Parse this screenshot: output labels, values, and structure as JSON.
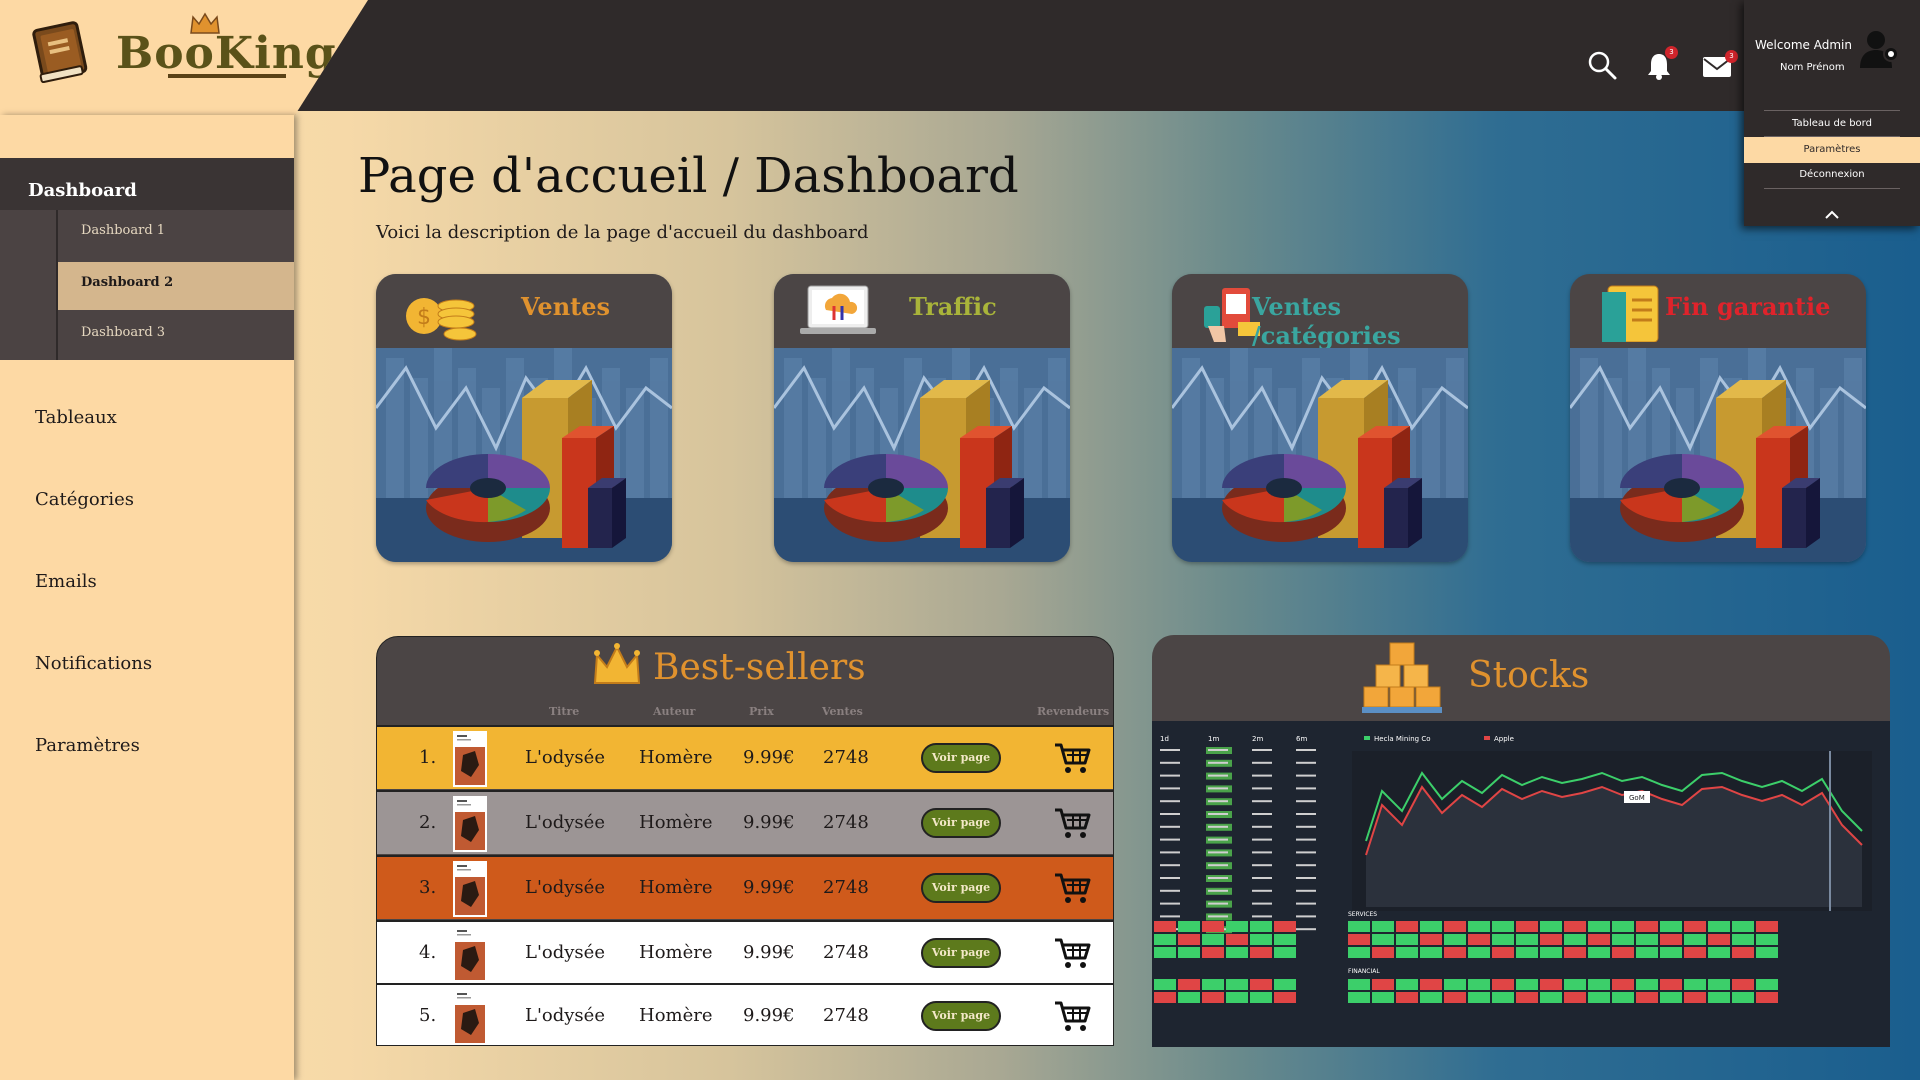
{
  "app": {
    "logo_text": "BooKing"
  },
  "header": {
    "notif_count": "3",
    "mail_count": "3"
  },
  "user_menu": {
    "welcome": "Welcome Admin",
    "name": "Nom Prénom",
    "items": [
      "Tableau de bord",
      "Paramètres",
      "Déconnexion"
    ]
  },
  "sidebar": {
    "section": "Dashboard",
    "sub_items": [
      "Dashboard 1",
      "Dashboard 2",
      "Dashboard 3"
    ],
    "items": [
      "Tableaux",
      "Catégories",
      "Emails",
      "Notifications",
      "Paramètres"
    ]
  },
  "page": {
    "title": "Page d'accueil / Dashboard",
    "description": "Voici la description de la page d'accueil du dashboard"
  },
  "cards": [
    {
      "title": "Ventes",
      "color": "#e0922e",
      "icon": "coins-icon"
    },
    {
      "title": "Traffic",
      "color": "#a9b43a",
      "icon": "laptop-cloud-icon"
    },
    {
      "title": "Ventes /catégories",
      "color": "#3aa6a0",
      "icon": "payment-icon"
    },
    {
      "title": "Fin garantie",
      "color": "#e0232b",
      "icon": "document-icon"
    }
  ],
  "bestsellers": {
    "title": "Best-sellers",
    "columns": [
      "Titre",
      "Auteur",
      "Prix",
      "Ventes",
      "Revendeurs"
    ],
    "button_label": "Voir page",
    "rows": [
      {
        "rank": "1.",
        "title": "L'odysée",
        "author": "Homère",
        "price": "9.99€",
        "sales": "2748",
        "color": "#f2b533"
      },
      {
        "rank": "2.",
        "title": "L'odysée",
        "author": "Homère",
        "price": "9.99€",
        "sales": "2748",
        "color": "#9c9595"
      },
      {
        "rank": "3.",
        "title": "L'odysée",
        "author": "Homère",
        "price": "9.99€",
        "sales": "2748",
        "color": "#cf5a1b"
      },
      {
        "rank": "4.",
        "title": "L'odysée",
        "author": "Homère",
        "price": "9.99€",
        "sales": "2748",
        "color": "#ffffff"
      },
      {
        "rank": "5.",
        "title": "L'odysée",
        "author": "Homère",
        "price": "9.99€",
        "sales": "2748",
        "color": "#ffffff"
      }
    ]
  },
  "stocks": {
    "title": "Stocks",
    "table_headers": [
      "1d",
      "1m",
      "2m",
      "6m"
    ],
    "legend": [
      "Hecla Mining Co",
      "Apple"
    ],
    "label_services": "SERVICES",
    "label_financial": "FINANCIAL",
    "tag": "GoM"
  }
}
